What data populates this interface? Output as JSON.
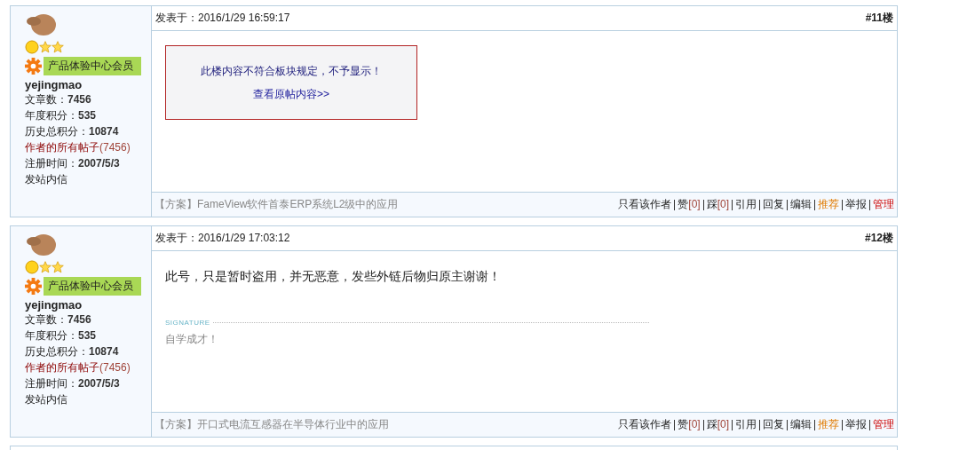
{
  "posts": [
    {
      "author": {
        "name": "yejingmao",
        "rank_title": "产品体验中心会员",
        "details": [
          {
            "kind": "stat",
            "label": "文章数：",
            "value": "7456"
          },
          {
            "kind": "stat",
            "label": "年度积分：",
            "value": "535"
          },
          {
            "kind": "stat",
            "label": "历史总积分：",
            "value": "10874"
          },
          {
            "kind": "link",
            "label": "作者的所有帖子",
            "value": "(7456)"
          },
          {
            "kind": "stat",
            "label": "注册时间：",
            "value": "2007/5/3"
          },
          {
            "kind": "plain",
            "label": "发站内信"
          }
        ]
      },
      "posted_label": "发表于：",
      "time": "2016/1/29 16:59:17",
      "floor": "#11楼",
      "body": {
        "kind": "hidden",
        "notice": "此楼内容不符合板块规定，不予显示！",
        "link": "查看原帖内容>>"
      },
      "footer_tag": "【方案】",
      "footer_title": "FameView软件首泰ERP系统L2级中的应用",
      "actions": [
        {
          "kind": "plain",
          "label": "只看该作者"
        },
        {
          "kind": "count",
          "label": "赞",
          "count": "[0]"
        },
        {
          "kind": "count",
          "label": "踩",
          "count": "[0]"
        },
        {
          "kind": "plain",
          "label": "引用"
        },
        {
          "kind": "plain",
          "label": "回复"
        },
        {
          "kind": "plain",
          "label": "编辑"
        },
        {
          "kind": "highlight",
          "label": "推荐"
        },
        {
          "kind": "plain",
          "label": "举报"
        },
        {
          "kind": "admin",
          "label": "管理"
        }
      ]
    },
    {
      "author": {
        "name": "yejingmao",
        "rank_title": "产品体验中心会员",
        "details": [
          {
            "kind": "stat",
            "label": "文章数：",
            "value": "7456"
          },
          {
            "kind": "stat",
            "label": "年度积分：",
            "value": "535"
          },
          {
            "kind": "stat",
            "label": "历史总积分：",
            "value": "10874"
          },
          {
            "kind": "link",
            "label": "作者的所有帖子",
            "value": "(7456)"
          },
          {
            "kind": "stat",
            "label": "注册时间：",
            "value": "2007/5/3"
          },
          {
            "kind": "plain",
            "label": "发站内信"
          }
        ]
      },
      "posted_label": "发表于：",
      "time": "2016/1/29 17:03:12",
      "floor": "#12楼",
      "body": {
        "kind": "text",
        "text": "此号，只是暂时盗用，并无恶意，发些外链后物归原主谢谢！",
        "signature_label": "SIGNATURE",
        "signature": "自学成才！"
      },
      "footer_tag": "【方案】",
      "footer_title": "开口式电流互感器在半导体行业中的应用",
      "actions": [
        {
          "kind": "plain",
          "label": "只看该作者"
        },
        {
          "kind": "count",
          "label": "赞",
          "count": "[0]"
        },
        {
          "kind": "count",
          "label": "踩",
          "count": "[0]"
        },
        {
          "kind": "plain",
          "label": "引用"
        },
        {
          "kind": "plain",
          "label": "回复"
        },
        {
          "kind": "plain",
          "label": "编辑"
        },
        {
          "kind": "highlight",
          "label": "推荐"
        },
        {
          "kind": "plain",
          "label": "举报"
        },
        {
          "kind": "admin",
          "label": "管理"
        }
      ]
    }
  ]
}
